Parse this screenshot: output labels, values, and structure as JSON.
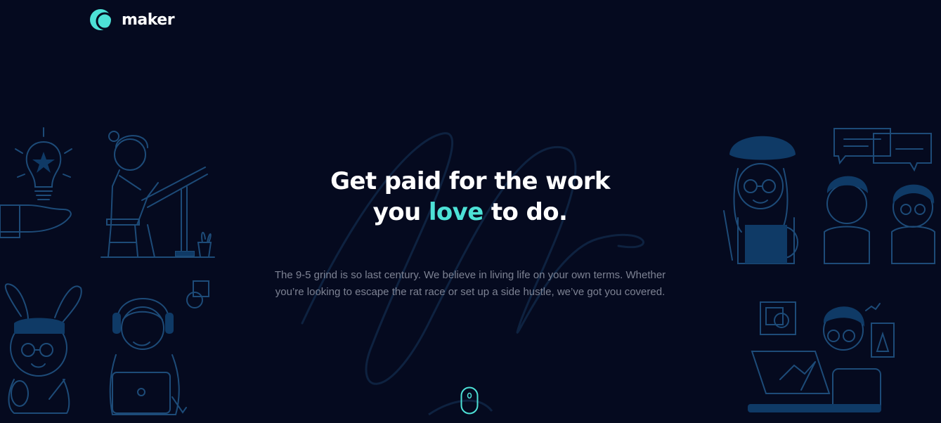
{
  "header": {
    "logo_text": "maker"
  },
  "hero": {
    "title_line1": "Get paid for the work",
    "title_line2_before": "you ",
    "title_line2_accent": "love",
    "title_line2_after": " to do.",
    "description": "The 9-5 grind is so last century. We believe in living life on your own terms. Whether you’re looking to escape the rat race or set up a side hustle, we’ve got you covered."
  },
  "icons": {
    "logo": "maker-logo-icon",
    "scroll": "mouse-scroll-icon"
  },
  "colors": {
    "background": "#050a1f",
    "accent": "#4de1d6",
    "illustration_stroke": "#1d4b78",
    "illustration_fill": "#0f3a66",
    "body_text": "#7d8293"
  }
}
